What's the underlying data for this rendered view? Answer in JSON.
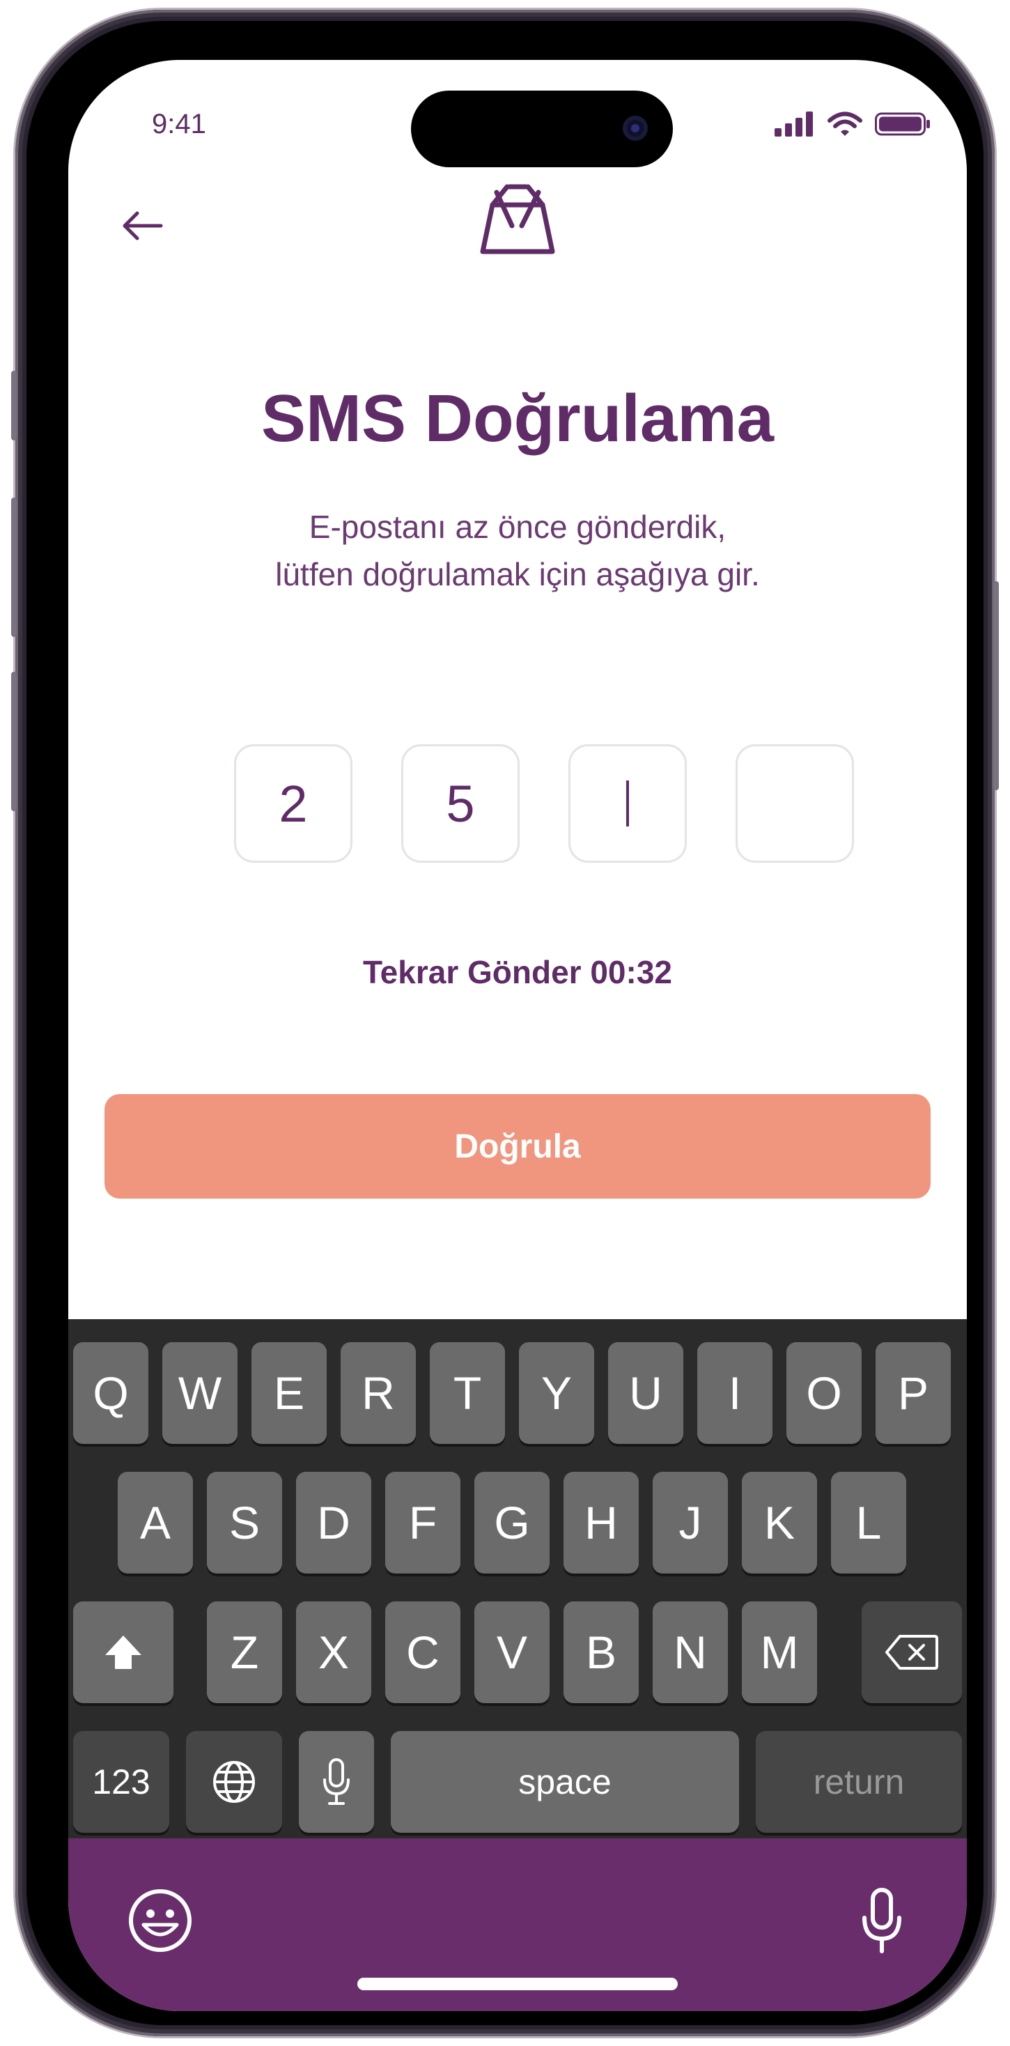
{
  "status": {
    "time": "9:41"
  },
  "header": {
    "back_icon": "arrow-left-icon",
    "logo_icon": "shopping-bag-logo-icon"
  },
  "main": {
    "title": "SMS Doğrulama",
    "subtitle_line1": "E-postanı az önce gönderdik,",
    "subtitle_line2": "lütfen doğrulamak için aşağıya gir.",
    "otp": [
      "2",
      "5",
      "",
      ""
    ],
    "resend_label": "Tekrar Gönder 00:32",
    "verify_label": "Doğrula"
  },
  "keyboard": {
    "row1": [
      "Q",
      "W",
      "E",
      "R",
      "T",
      "Y",
      "U",
      "I",
      "O",
      "P"
    ],
    "row2": [
      "A",
      "S",
      "D",
      "F",
      "G",
      "H",
      "J",
      "K",
      "L"
    ],
    "row3": [
      "Z",
      "X",
      "C",
      "V",
      "B",
      "N",
      "M"
    ],
    "numbers_label": "123",
    "space_label": "space",
    "return_label": "return"
  },
  "colors": {
    "brand": "#5f2c68",
    "accent": "#f0957e",
    "bottom_bar": "#6a2d6b"
  }
}
